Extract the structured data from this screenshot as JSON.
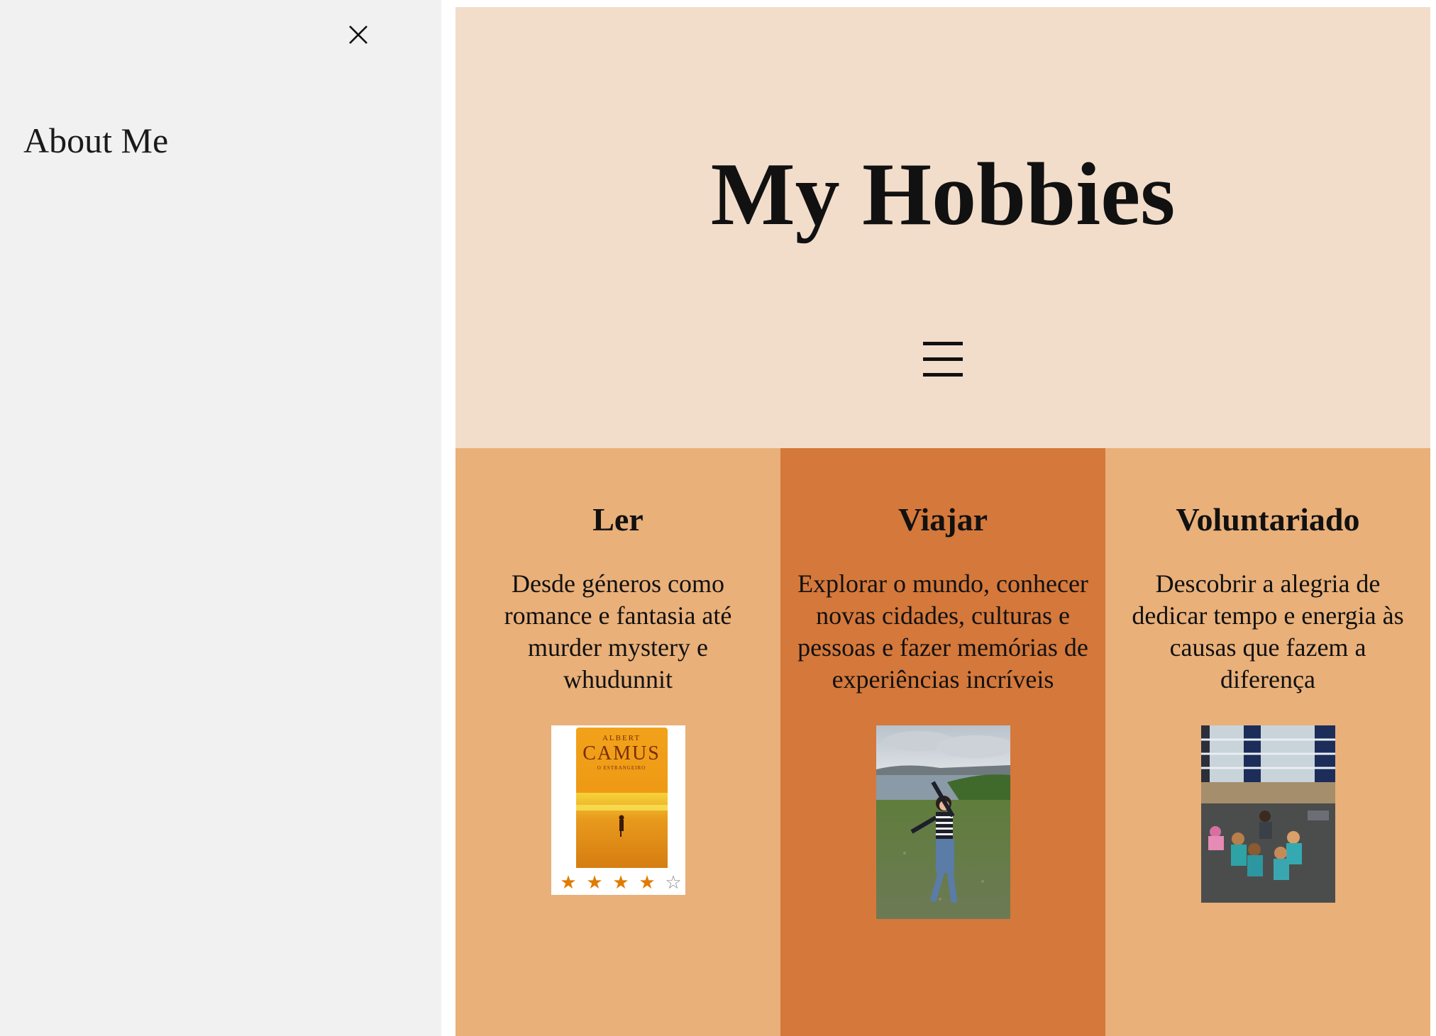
{
  "sidebar": {
    "close_icon": "close-icon",
    "about_label": "About Me"
  },
  "header": {
    "title": "My Hobbies",
    "menu_icon": "hamburger-menu-icon"
  },
  "hobbies": [
    {
      "title": "Ler",
      "description": "Desde géneros como romance e fantasia até murder mystery e whudunnit",
      "image": {
        "kind": "book-cover",
        "author": "ALBERT",
        "book_title": "CAMUS",
        "subtitle": "O ESTRANGEIRO",
        "rating": 4,
        "rating_max": 5,
        "star_color": "#e07b00"
      }
    },
    {
      "title": "Viajar",
      "description": "Explorar o mundo, conhecer novas cidades, culturas e pessoas e fazer memórias de experiências incríveis",
      "image": {
        "kind": "travel-photo"
      }
    },
    {
      "title": "Voluntariado",
      "description": "Descobrir a alegria de dedicar tempo e energia às causas que fazem a diferença",
      "image": {
        "kind": "volunteering-photo"
      }
    }
  ],
  "colors": {
    "sidebar_bg": "#f1f1f1",
    "header_bg": "#f2ddcb",
    "column_light": "#e9b07a",
    "column_dark": "#d5783b"
  }
}
